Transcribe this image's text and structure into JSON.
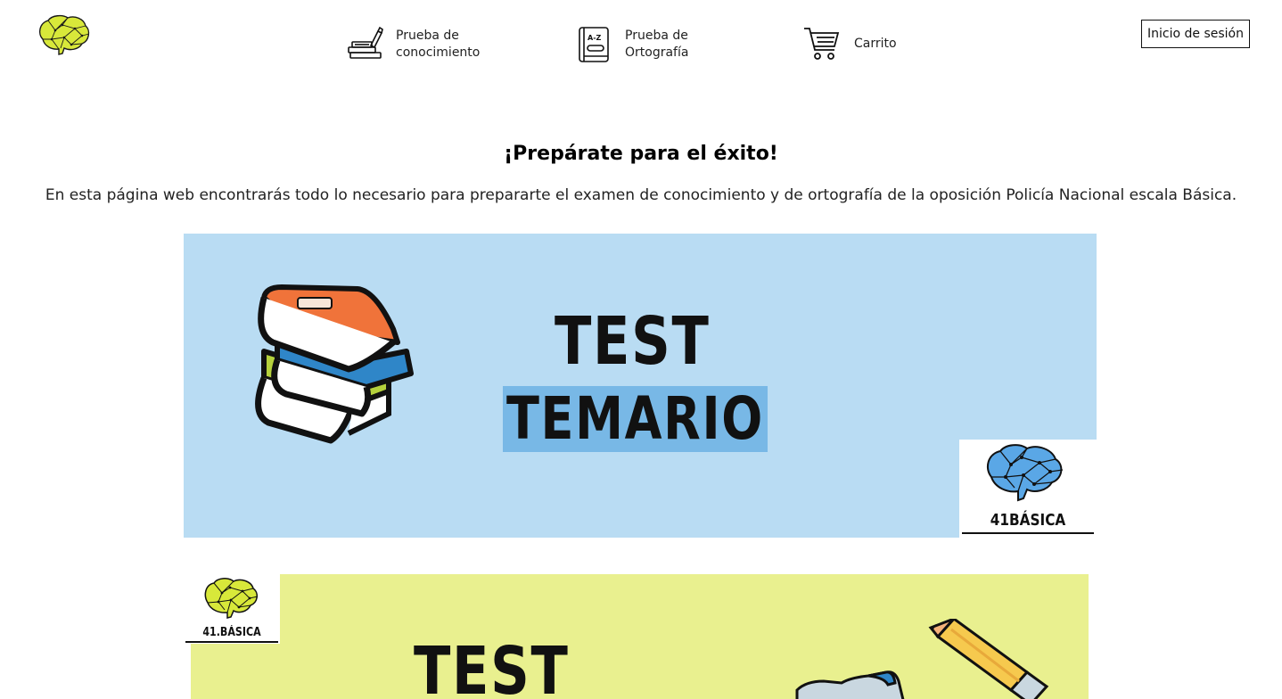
{
  "nav": {
    "knowledge_label": "Prueba de conocimiento",
    "spelling_label": "Prueba de Ortografía",
    "cart_label": "Carrito",
    "login_label": "Inicio de sesión",
    "spelling_icon_text": "A-Z"
  },
  "hero": {
    "title": "¡Prepárate para el éxito!",
    "description": "En esta página web encontrarás todo lo necesario para prepararte el examen de conocimiento y de ortografía de la oposición Policía Nacional escala Básica."
  },
  "banners": [
    {
      "line1": "TEST",
      "line2": "TEMARIO",
      "brand": "41BÁSICA",
      "background": "#b9dcf3",
      "highlight": "#78b8e6",
      "icons": [
        "books-icon",
        "brain-logo-blue"
      ]
    },
    {
      "line1": "TEST",
      "brand": "41.BÁSICA",
      "background": "#e9f08f",
      "icons": [
        "brain-logo-yellow",
        "pencil-icon"
      ]
    }
  ],
  "colors": {
    "logo_yellow": "#d8e83a",
    "logo_blue": "#5aa7e6",
    "book_orange": "#f0733a",
    "book_green": "#b5d13c",
    "book_blue": "#2f86c8"
  }
}
